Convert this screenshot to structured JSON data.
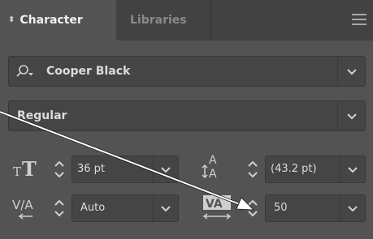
{
  "tabs": {
    "active_label": "Character",
    "inactive_label": "Libraries"
  },
  "font": {
    "family": "Cooper Black",
    "style": "Regular"
  },
  "size": {
    "font_size": "36 pt",
    "leading": "(43.2 pt)"
  },
  "spacing": {
    "kerning": "Auto",
    "tracking": "50"
  },
  "icons": [
    "collapse-chevron-icon",
    "panel-menu-icon",
    "font-search-icon",
    "dropdown-arrow-icon",
    "font-size-icon",
    "leading-icon",
    "kerning-icon",
    "tracking-icon",
    "stepper-icon",
    "arrow-annotation-icon"
  ],
  "colors": {
    "panel_bg": "#535353",
    "tab_bar_bg": "#424242",
    "field_bg": "#454545",
    "text": "#dcdcdc",
    "annotation": "#ffffff"
  }
}
